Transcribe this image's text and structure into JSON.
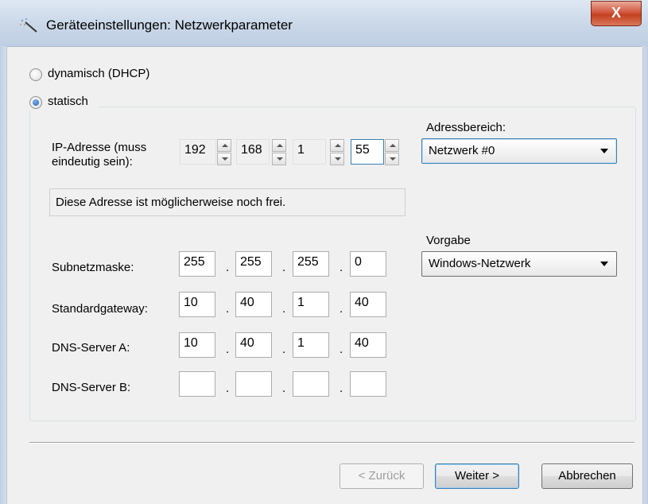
{
  "window": {
    "title": "Geräteeinstellungen: Netzwerkparameter",
    "close_label": "X",
    "icon": "magic-wand-icon"
  },
  "mode": {
    "dhcp_label": "dynamisch (DHCP)",
    "static_label": "statisch",
    "selected": "statisch"
  },
  "ip": {
    "label_line1": "IP-Adresse (muss",
    "label_line2": "eindeutig sein):",
    "octets": [
      "192",
      "168",
      "1",
      "55"
    ],
    "hint": "Diese Adresse ist möglicherweise noch frei."
  },
  "address_range": {
    "label": "Adressbereich:",
    "value": "Netzwerk #0"
  },
  "preset": {
    "label": "Vorgabe",
    "value": "Windows-Netzwerk"
  },
  "subnet": {
    "label": "Subnetzmaske:",
    "octets": [
      "255",
      "255",
      "255",
      "0"
    ]
  },
  "gateway": {
    "label": "Standardgateway:",
    "octets": [
      "10",
      "40",
      "1",
      "40"
    ]
  },
  "dns_a": {
    "label": "DNS-Server A:",
    "octets": [
      "10",
      "40",
      "1",
      "40"
    ]
  },
  "dns_b": {
    "label": "DNS-Server B:",
    "octets": [
      "",
      "",
      "",
      ""
    ]
  },
  "separator_dot": ".",
  "buttons": {
    "back": "< Zurück",
    "next": "Weiter >",
    "cancel": "Abbrechen"
  }
}
